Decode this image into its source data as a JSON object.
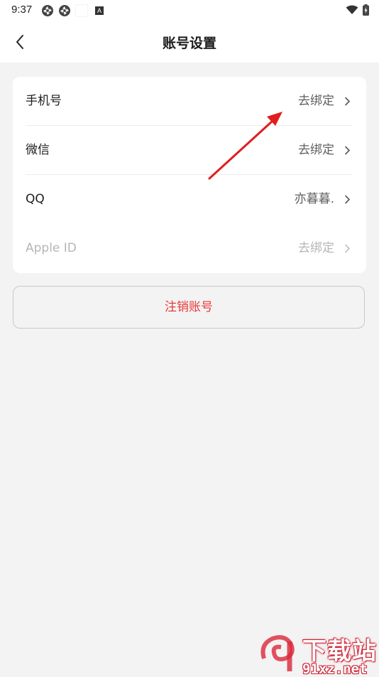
{
  "status_bar": {
    "time": "9:37",
    "badge": "A"
  },
  "header": {
    "title": "账号设置"
  },
  "accounts": [
    {
      "label": "手机号",
      "value": "去绑定",
      "enabled": true
    },
    {
      "label": "微信",
      "value": "去绑定",
      "enabled": true
    },
    {
      "label": "QQ",
      "value": "亦暮暮.",
      "enabled": true
    },
    {
      "label": "Apple ID",
      "value": "去绑定",
      "enabled": false
    }
  ],
  "logout_label": "注销账号",
  "watermark": {
    "top": "下载站",
    "bottom": "91xz.net"
  },
  "colors": {
    "background": "#f3f3f3",
    "card": "#ffffff",
    "danger_text": "#e8393a",
    "annotation_arrow": "#e01e1e"
  }
}
